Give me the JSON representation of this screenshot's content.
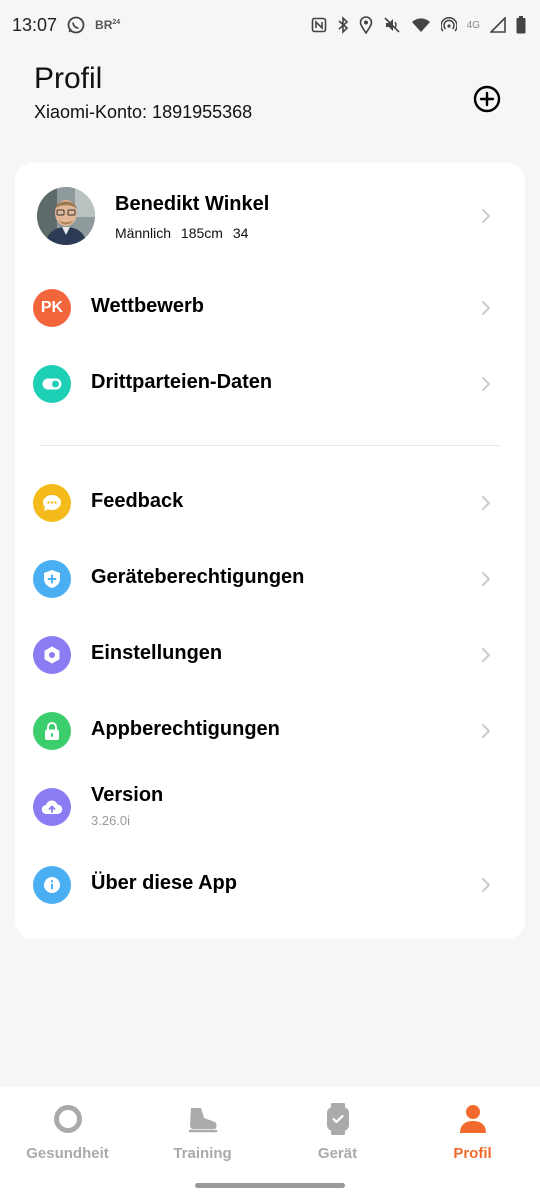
{
  "status_bar": {
    "time": "13:07",
    "network": "4G",
    "br_logo": "BR",
    "br_logo_sup": "24",
    "icons": [
      "whatsapp-icon",
      "nfc-icon",
      "bluetooth-icon",
      "location-icon",
      "mute-icon",
      "wifi-icon",
      "hotspot-icon",
      "signal-icon",
      "battery-icon"
    ]
  },
  "header": {
    "title": "Profil",
    "account_label": "Xiaomi-Konto: 1891955368",
    "add_icon": "add-circle-icon"
  },
  "profile": {
    "name": "Benedikt Winkel",
    "gender": "Männlich",
    "height": "185cm",
    "age": "34"
  },
  "menu_top": [
    {
      "label": "Wettbewerb",
      "icon": "pk-icon",
      "icon_text": "PK",
      "color": "#f2643a"
    },
    {
      "label": "Drittparteien-Daten",
      "icon": "toggle-icon",
      "color": "#1dcfb4"
    }
  ],
  "menu_bottom": [
    {
      "label": "Feedback",
      "icon": "chat-bubble-icon",
      "color": "#f5bb1c"
    },
    {
      "label": "Geräteberechtigungen",
      "icon": "shield-plus-icon",
      "color": "#4aaef3"
    },
    {
      "label": "Einstellungen",
      "icon": "hexagon-gear-icon",
      "color": "#8a7cf2"
    },
    {
      "label": "Appberechtigungen",
      "icon": "lock-icon",
      "color": "#3ccd6c"
    },
    {
      "label": "Version",
      "icon": "cloud-upload-icon",
      "color": "#8a7cf2",
      "value": "3.26.0i"
    },
    {
      "label": "Über diese App",
      "icon": "info-icon",
      "color": "#4aaef3"
    }
  ],
  "bottom_nav": [
    {
      "label": "Gesundheit",
      "icon": "ring-icon",
      "active": false
    },
    {
      "label": "Training",
      "icon": "shoe-icon",
      "active": false
    },
    {
      "label": "Gerät",
      "icon": "watch-icon",
      "active": false
    },
    {
      "label": "Profil",
      "icon": "person-icon",
      "active": true
    }
  ],
  "colors": {
    "accent": "#f26a2e",
    "inactive_nav": "#aaaaaa",
    "background": "#f6f6f6"
  }
}
